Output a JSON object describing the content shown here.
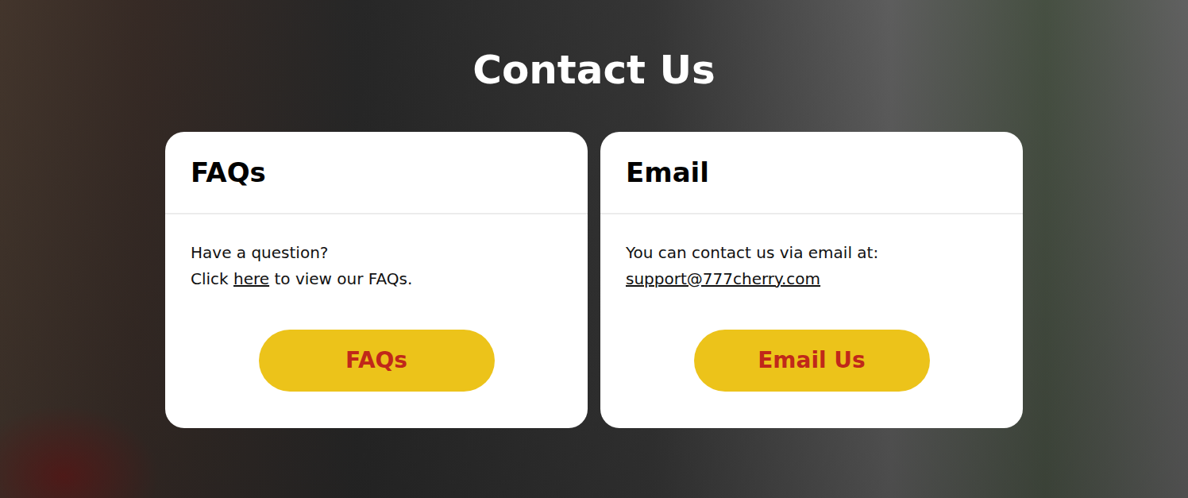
{
  "title": "Contact Us",
  "cards": [
    {
      "heading": "FAQs",
      "lines": [
        [
          {
            "text": "Have a question?",
            "kind": "text"
          }
        ],
        [
          {
            "text": "Click ",
            "kind": "text"
          },
          {
            "text": "here",
            "kind": "link"
          },
          {
            "text": " to view our FAQs.",
            "kind": "text"
          }
        ]
      ],
      "button": "FAQs"
    },
    {
      "heading": "Email",
      "lines": [
        [
          {
            "text": "You can contact us via email at:",
            "kind": "text"
          }
        ],
        [
          {
            "text": "support@777cherry.com",
            "kind": "link"
          }
        ]
      ],
      "button": "Email Us"
    }
  ]
}
